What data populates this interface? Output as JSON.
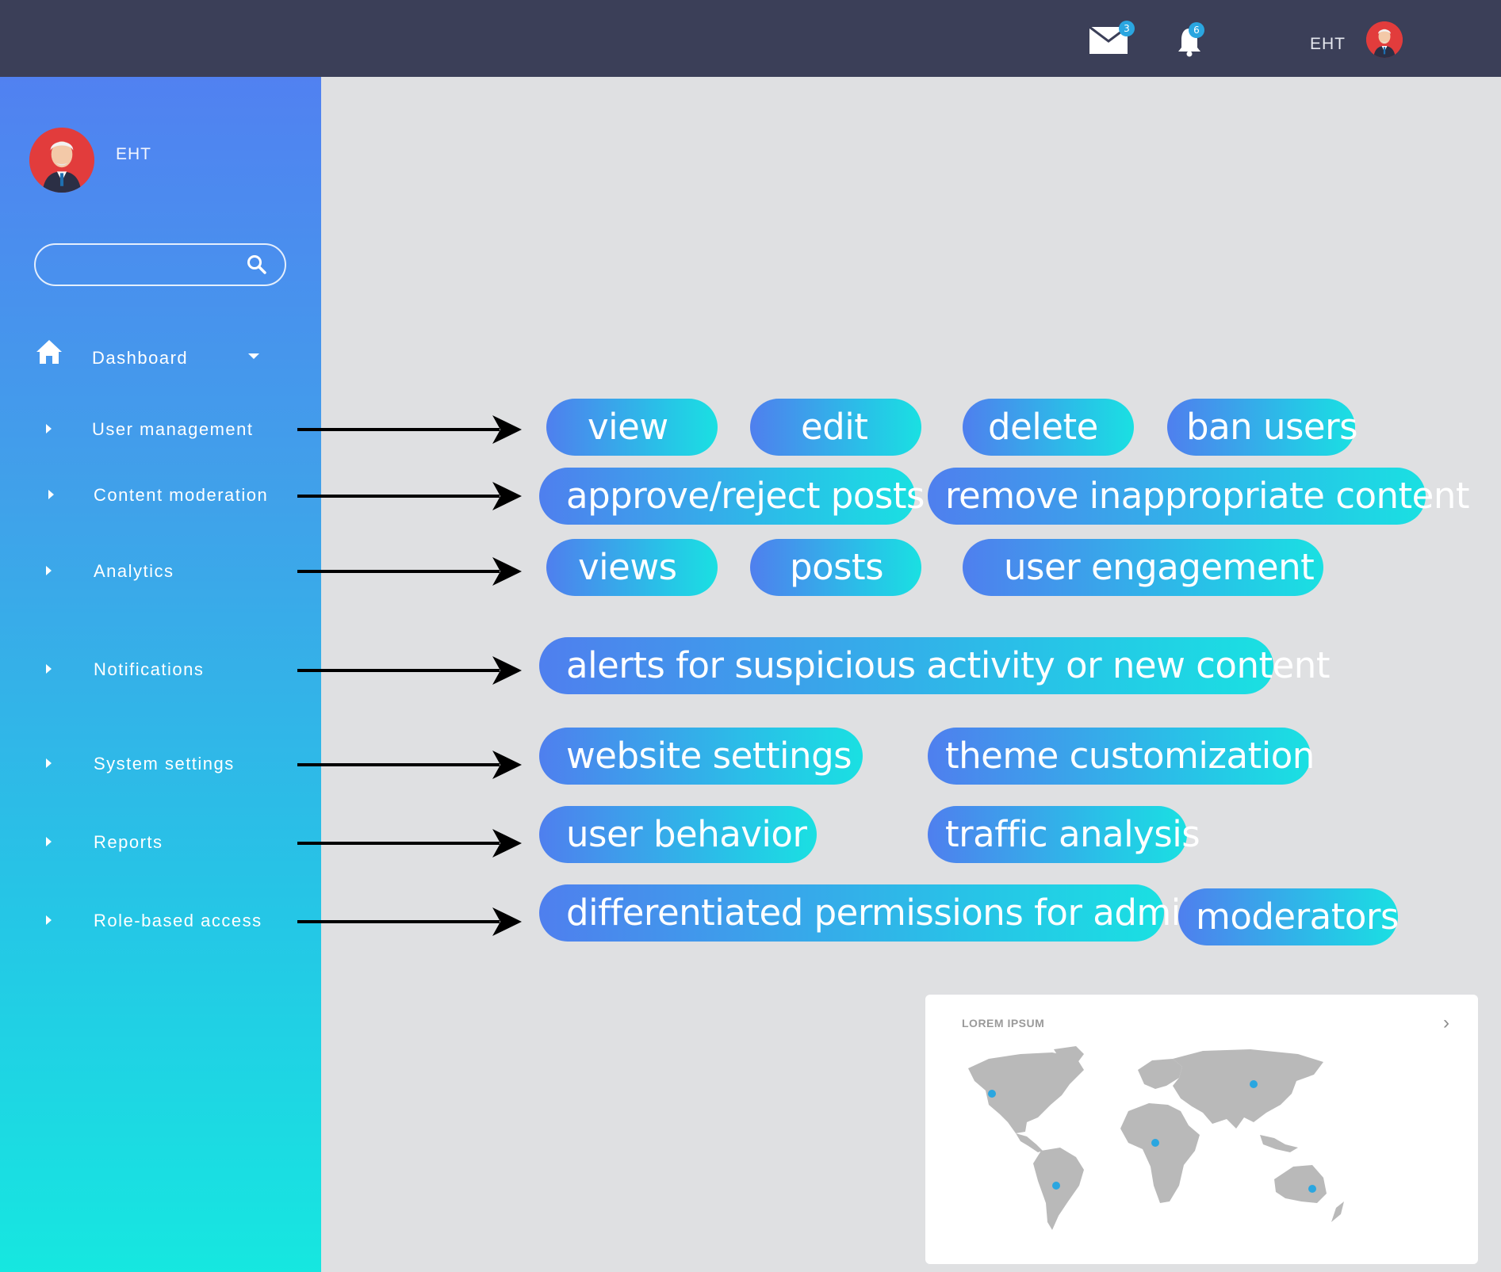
{
  "topbar": {
    "mail_count": "3",
    "notification_count": "6",
    "username": "EHT"
  },
  "sidebar": {
    "username": "EHT",
    "search": {
      "placeholder": ""
    },
    "dashboard_label": "Dashboard",
    "items": [
      {
        "label": "User management"
      },
      {
        "label": "Content moderation"
      },
      {
        "label": "Analytics"
      },
      {
        "label": "Notifications"
      },
      {
        "label": "System settings"
      },
      {
        "label": "Reports"
      },
      {
        "label": "Role-based access"
      }
    ]
  },
  "features": {
    "user_management": [
      "view",
      "edit",
      "delete",
      "ban users"
    ],
    "content_moderation": [
      "approve/reject posts",
      "remove inappropriate content"
    ],
    "analytics": [
      "views",
      "posts",
      "user engagement"
    ],
    "notifications": [
      "alerts for suspicious activity or new content"
    ],
    "system_settings": [
      "website settings",
      "theme customization"
    ],
    "reports": [
      "user behavior",
      "traffic analysis"
    ],
    "role_based_access": [
      "differentiated permissions for admins",
      "moderators"
    ]
  },
  "map_card": {
    "title": "LOREM IPSUM",
    "chevron": "›"
  },
  "colors": {
    "topbar": "#3b3f58",
    "sidebar_top": "#5181f1",
    "sidebar_bottom": "#16e7e0",
    "pill_start": "#4f7fee",
    "pill_end": "#1ae0e2",
    "badge": "#2aa6e0",
    "map_land": "#b9b9b9",
    "map_dot": "#2aa6e0"
  },
  "icons": {
    "mail": "mail-icon",
    "bell": "bell-icon",
    "home": "home-icon",
    "search": "search-icon",
    "avatar": "avatar-old-man"
  }
}
